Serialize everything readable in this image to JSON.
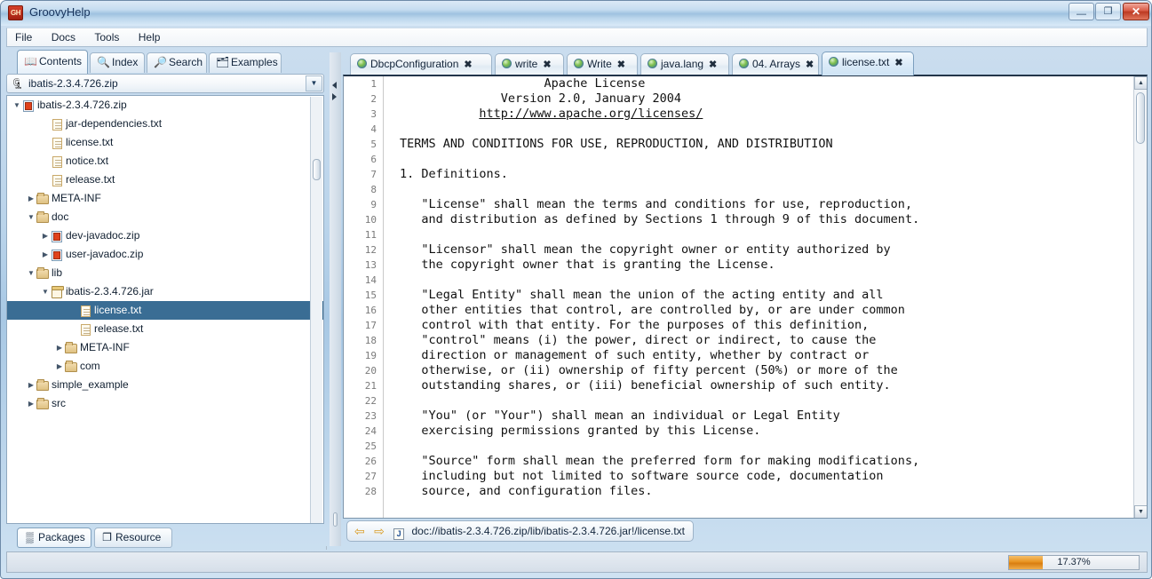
{
  "window": {
    "title": "GroovyHelp",
    "app_icon": "GH",
    "minimize": "minimize-button",
    "maximize": "maximize-button",
    "close": "close-button",
    "min_glyph": "—",
    "max_glyph": "❐",
    "close_glyph": "✕"
  },
  "menubar": {
    "items": [
      {
        "label": "File"
      },
      {
        "label": "Docs"
      },
      {
        "label": "Tools"
      },
      {
        "label": "Help"
      }
    ]
  },
  "left_panel": {
    "tabs": [
      {
        "label": "Contents",
        "icon": "book-icon",
        "glyph": "📖",
        "selected": true
      },
      {
        "label": "Index",
        "icon": "magnifier-icon",
        "glyph": "🔍",
        "selected": false
      },
      {
        "label": "Search",
        "icon": "search-page-icon",
        "glyph": "🔎",
        "selected": false
      },
      {
        "label": "Examples",
        "icon": "examples-icon",
        "glyph": "🗂",
        "selected": false
      }
    ],
    "combo": {
      "value": "ibatis-2.3.4.726.zip",
      "icon": "zip-archive-icon",
      "icon_glyph": "🗜",
      "arrow_glyph": "▼"
    },
    "tree": [
      {
        "label": "ibatis-2.3.4.726.zip",
        "indent": 0,
        "toggle": "▼",
        "icon": "zip",
        "selected": false
      },
      {
        "label": "jar-dependencies.txt",
        "indent": 2,
        "toggle": "",
        "icon": "file",
        "selected": false
      },
      {
        "label": "license.txt",
        "indent": 2,
        "toggle": "",
        "icon": "file",
        "selected": false
      },
      {
        "label": "notice.txt",
        "indent": 2,
        "toggle": "",
        "icon": "file",
        "selected": false
      },
      {
        "label": "release.txt",
        "indent": 2,
        "toggle": "",
        "icon": "file",
        "selected": false
      },
      {
        "label": "META-INF",
        "indent": 1,
        "toggle": "▶",
        "icon": "folder",
        "selected": false
      },
      {
        "label": "doc",
        "indent": 1,
        "toggle": "▼",
        "icon": "folder",
        "selected": false
      },
      {
        "label": "dev-javadoc.zip",
        "indent": 2,
        "toggle": "▶",
        "icon": "zip",
        "selected": false
      },
      {
        "label": "user-javadoc.zip",
        "indent": 2,
        "toggle": "▶",
        "icon": "zip",
        "selected": false
      },
      {
        "label": "lib",
        "indent": 1,
        "toggle": "▼",
        "icon": "folder",
        "selected": false
      },
      {
        "label": "ibatis-2.3.4.726.jar",
        "indent": 2,
        "toggle": "▼",
        "icon": "jar",
        "selected": false
      },
      {
        "label": "license.txt",
        "indent": 4,
        "toggle": "",
        "icon": "file",
        "selected": true
      },
      {
        "label": "release.txt",
        "indent": 4,
        "toggle": "",
        "icon": "file",
        "selected": false
      },
      {
        "label": "META-INF",
        "indent": 3,
        "toggle": "▶",
        "icon": "folder",
        "selected": false
      },
      {
        "label": "com",
        "indent": 3,
        "toggle": "▶",
        "icon": "folder",
        "selected": false
      },
      {
        "label": "simple_example",
        "indent": 1,
        "toggle": "▶",
        "icon": "folder",
        "selected": false
      },
      {
        "label": "src",
        "indent": 1,
        "toggle": "▶",
        "icon": "folder",
        "selected": false
      }
    ],
    "bottom_tabs": [
      {
        "label": "Packages",
        "icon": "packages-icon",
        "glyph": "▒",
        "selected": true
      },
      {
        "label": "Resource",
        "icon": "resource-icon",
        "glyph": "❐",
        "selected": false
      }
    ]
  },
  "right_panel": {
    "tabs": [
      {
        "label": "DbcpConfiguration",
        "selected": false,
        "close": "✖"
      },
      {
        "label": "write",
        "selected": false,
        "close": "✖"
      },
      {
        "label": "Write",
        "selected": false,
        "close": "✖"
      },
      {
        "label": "java.lang",
        "selected": false,
        "close": "✖"
      },
      {
        "label": "04. Arrays",
        "selected": false,
        "close": "✖"
      },
      {
        "label": "license.txt",
        "selected": true,
        "close": "✖"
      }
    ],
    "document": {
      "first_line": 1,
      "lines": [
        "                    Apache License",
        "              Version 2.0, January 2004",
        "           <u>http://www.apache.org/licenses/</u>",
        "",
        "TERMS AND CONDITIONS FOR USE, REPRODUCTION, AND DISTRIBUTION",
        "",
        "1. Definitions.",
        "",
        "   \"License\" shall mean the terms and conditions for use, reproduction,",
        "   and distribution as defined by Sections 1 through 9 of this document.",
        "",
        "   \"Licensor\" shall mean the copyright owner or entity authorized by",
        "   the copyright owner that is granting the License.",
        "",
        "   \"Legal Entity\" shall mean the union of the acting entity and all",
        "   other entities that control, are controlled by, or are under common",
        "   control with that entity. For the purposes of this definition,",
        "   \"control\" means (i) the power, direct or indirect, to cause the",
        "   direction or management of such entity, whether by contract or",
        "   otherwise, or (ii) ownership of fifty percent (50%) or more of the",
        "   outstanding shares, or (iii) beneficial ownership of such entity.",
        "",
        "   \"You\" (or \"Your\") shall mean an individual or Legal Entity",
        "   exercising permissions granted by this License.",
        "",
        "   \"Source\" form shall mean the preferred form for making modifications,",
        "   including but not limited to software source code, documentation",
        "   source, and configuration files."
      ]
    },
    "navbar": {
      "back_glyph": "⇦",
      "forward_glyph": "⇨",
      "doc_icon": "J",
      "path": "doc://ibatis-2.3.4.726.zip/lib/ibatis-2.3.4.726.jar!/license.txt"
    }
  },
  "statusbar": {
    "progress_label": "17.37%",
    "progress_value": 17.37,
    "progress_color": "#e8931f"
  }
}
